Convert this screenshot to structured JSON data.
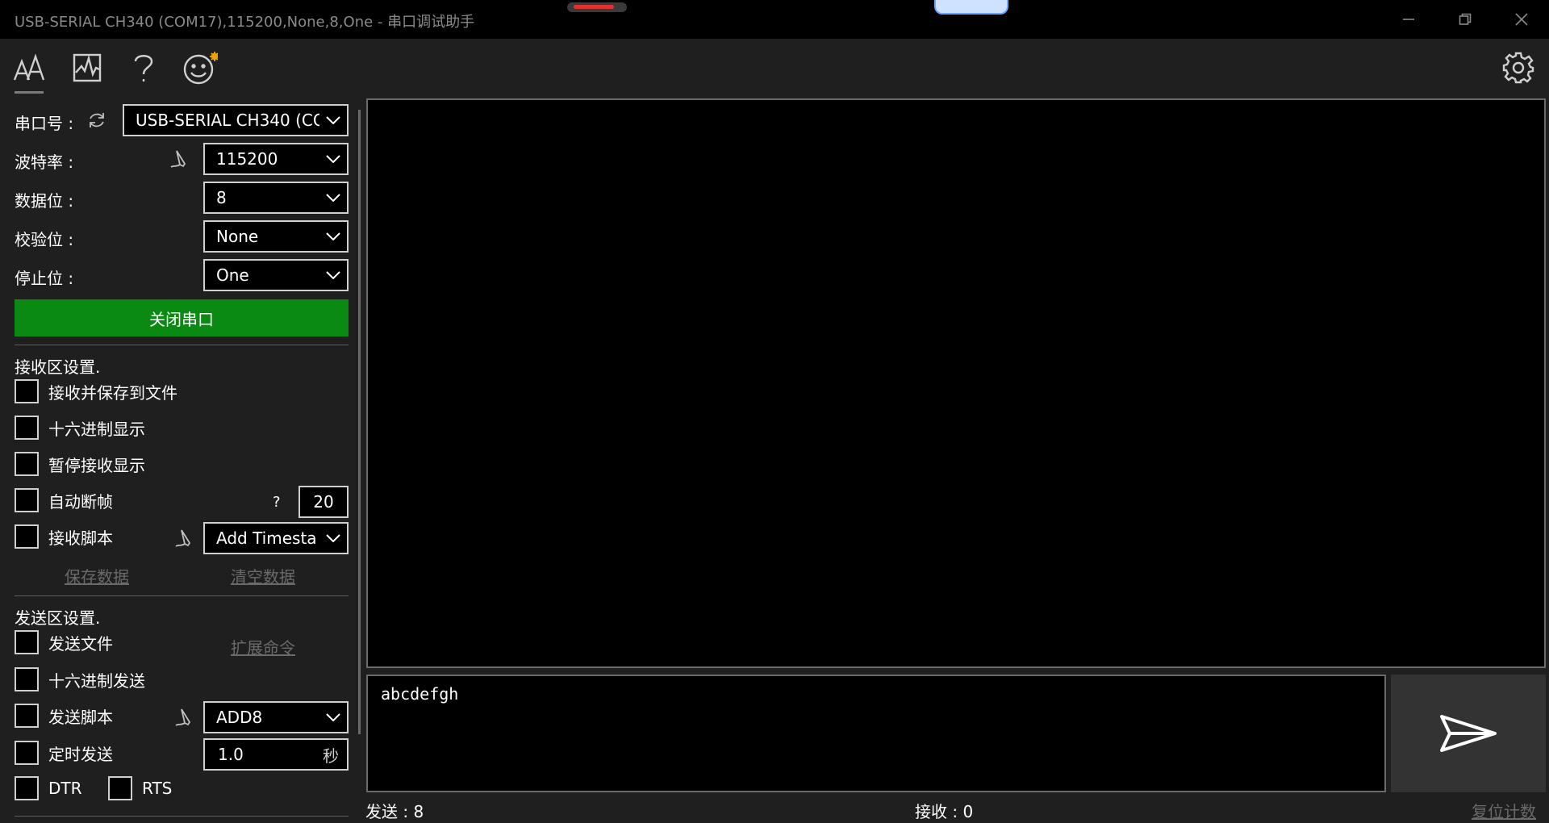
{
  "window": {
    "title": "USB-SERIAL CH340 (COM17),115200,None,8,One - 串口调试助手"
  },
  "toolbar": {
    "icons": [
      "text-format-icon",
      "chart-icon",
      "help-icon",
      "smile-icon",
      "settings-icon"
    ]
  },
  "serial": {
    "port_label": "串口号 :",
    "port_value": "USB-SERIAL CH340 (COM",
    "baud_label": "波特率 :",
    "baud_value": "115200",
    "databits_label": "数据位 :",
    "databits_value": "8",
    "parity_label": "校验位 :",
    "parity_value": "None",
    "stopbits_label": "停止位 :",
    "stopbits_value": "One",
    "close_button": "关闭串口"
  },
  "receive_settings": {
    "header": "接收区设置.",
    "save_to_file": "接收并保存到文件",
    "hex_display": "十六进制显示",
    "pause_display": "暂停接收显示",
    "auto_frame": "自动断帧",
    "auto_frame_help": "?",
    "auto_frame_value": "20",
    "receive_script": "接收脚本",
    "receive_script_value": "Add Timesta",
    "save_data": "保存数据",
    "clear_data": "清空数据"
  },
  "send_settings": {
    "header": "发送区设置.",
    "send_file": "发送文件",
    "extend_cmd": "扩展命令",
    "hex_send": "十六进制发送",
    "send_script": "发送脚本",
    "send_script_value": "ADD8",
    "timed_send": "定时发送",
    "timed_value": "1.0",
    "timed_unit": "秒",
    "dtr": "DTR",
    "rts": "RTS"
  },
  "main": {
    "send_text": "abcdefgh"
  },
  "status": {
    "sent": "发送 : 8",
    "received": "接收 : 0",
    "reset": "复位计数"
  },
  "colors": {
    "accent_green": "#0a8a12",
    "background": "#1f1f1f",
    "panel": "#000000"
  }
}
